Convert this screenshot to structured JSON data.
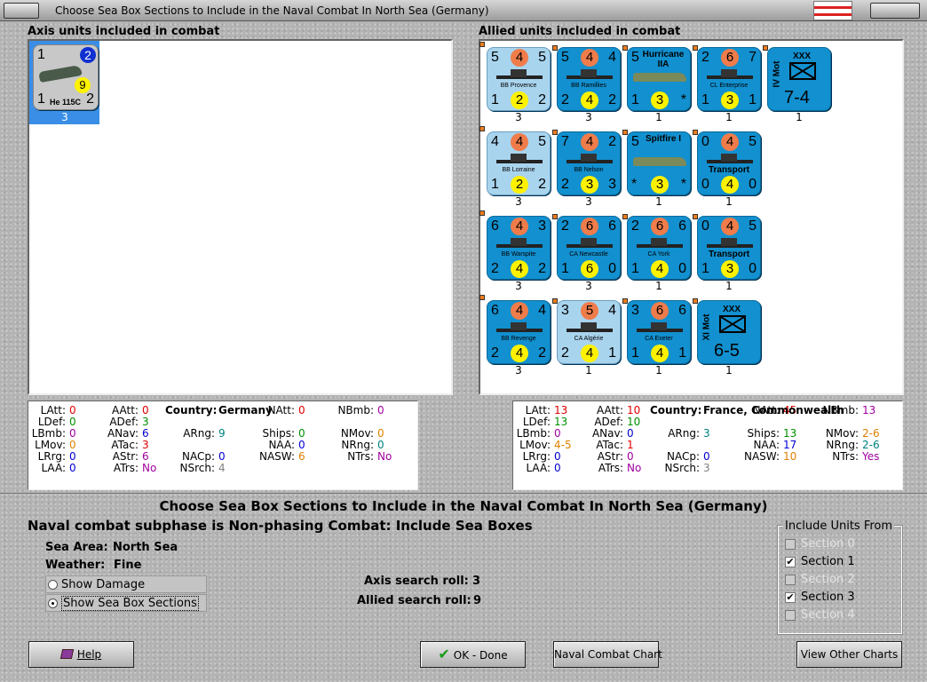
{
  "window": {
    "title": "Choose Sea Box Sections to Include in the Naval Combat In North Sea (Germany)"
  },
  "axis": {
    "heading": "Axis units included in combat",
    "units": [
      {
        "name": "He 115C",
        "tl": "1",
        "tr": "2",
        "mid": "9",
        "bl": "1",
        "br": "2",
        "count": "3"
      }
    ],
    "stats": {
      "LAtt": "0",
      "LDef": "0",
      "LBmb": "0",
      "LMov": "0",
      "LRrg": "0",
      "LAA": "0",
      "AAtt": "0",
      "ADef": "3",
      "ANav": "6",
      "ATac": "3",
      "AStr": "6",
      "ATrs": "No",
      "ARng": "9",
      "NACp": "0",
      "NSrch": "4",
      "country_label": "Country:",
      "country": "Germany",
      "NAtt": "0",
      "Ships": "0",
      "NAA": "0",
      "NASW": "6",
      "NBmb": "0",
      "NMov": "0",
      "NRng": "0",
      "NTrs": "No"
    }
  },
  "allied": {
    "heading": "Allied units included in combat",
    "units": [
      {
        "name": "BB Provence",
        "tl": "5",
        "o": "4",
        "tr": "5",
        "bl": "1",
        "y": "2",
        "br": "2",
        "count": "3",
        "light": true
      },
      {
        "name": "BB Ramillies",
        "tl": "5",
        "o": "4",
        "tr": "4",
        "bl": "2",
        "y": "4",
        "br": "2",
        "count": "3",
        "light": false
      },
      {
        "name": "Hurricane IIA",
        "tl": "5",
        "o": "",
        "tr": "",
        "bl": "1",
        "y": "3",
        "br": "*",
        "count": "1",
        "light": false
      },
      {
        "name": "CL Enterprise",
        "tl": "2",
        "o": "6",
        "tr": "7",
        "bl": "1",
        "y": "3",
        "br": "1",
        "count": "1",
        "light": false
      },
      {
        "name": "IV Mot",
        "corps": "XXX",
        "value": "7-4",
        "count": "1"
      },
      {
        "name": "BB Lorraine",
        "tl": "4",
        "o": "4",
        "tr": "5",
        "bl": "1",
        "y": "2",
        "br": "2",
        "count": "3",
        "light": true
      },
      {
        "name": "BB Nelson",
        "tl": "7",
        "o": "4",
        "tr": "2",
        "bl": "2",
        "y": "3",
        "br": "3",
        "count": "3",
        "light": false
      },
      {
        "name": "Spitfire I",
        "tl": "5",
        "o": "",
        "tr": "",
        "bl": "*",
        "y": "3",
        "br": "*",
        "count": "1",
        "light": false
      },
      {
        "name": "Transport",
        "tl": "0",
        "o": "4",
        "tr": "5",
        "bl": "0",
        "y": "4",
        "br": "0",
        "count": "1",
        "light": false
      },
      {
        "name": "BB Warspite",
        "tl": "6",
        "o": "4",
        "tr": "3",
        "bl": "2",
        "y": "4",
        "br": "2",
        "count": "3",
        "light": false
      },
      {
        "name": "CA Newcastle",
        "tl": "2",
        "o": "6",
        "tr": "6",
        "bl": "1",
        "y": "6",
        "br": "0",
        "count": "3",
        "light": false
      },
      {
        "name": "CA York",
        "tl": "2",
        "o": "6",
        "tr": "6",
        "bl": "1",
        "y": "4",
        "br": "0",
        "count": "1",
        "light": false
      },
      {
        "name": "Transport",
        "tl": "0",
        "o": "4",
        "tr": "5",
        "bl": "1",
        "y": "3",
        "br": "0",
        "count": "1",
        "light": false
      },
      {
        "name": "BB Revenge",
        "tl": "6",
        "o": "4",
        "tr": "4",
        "bl": "2",
        "y": "4",
        "br": "2",
        "count": "3",
        "light": false
      },
      {
        "name": "CA Algérie",
        "tl": "3",
        "o": "5",
        "tr": "4",
        "bl": "2",
        "y": "4",
        "br": "1",
        "count": "1",
        "light": true
      },
      {
        "name": "CA Exeter",
        "tl": "3",
        "o": "6",
        "tr": "6",
        "bl": "1",
        "y": "4",
        "br": "1",
        "count": "1",
        "light": false
      },
      {
        "name": "XI Mot",
        "corps": "XXX",
        "value": "6-5",
        "count": "1"
      }
    ],
    "stats": {
      "LAtt": "13",
      "LDef": "13",
      "LBmb": "0",
      "LMov": "4-5",
      "LRrg": "0",
      "LAA": "0",
      "AAtt": "10",
      "ADef": "10",
      "ANav": "0",
      "ATac": "1",
      "AStr": "0",
      "ATrs": "No",
      "ARng": "3",
      "NACp": "0",
      "NSrch": "3",
      "country_label": "Country:",
      "country": "France, Commonwealth",
      "NAtt": "45",
      "Ships": "13",
      "NAA": "17",
      "NASW": "10",
      "NBmb": "13",
      "NMov": "2-6",
      "NRng": "2-6",
      "NTrs": "Yes"
    }
  },
  "labels": {
    "LAtt": "LAtt:",
    "LDef": "LDef:",
    "LBmb": "LBmb:",
    "LMov": "LMov:",
    "LRrg": "LRrg:",
    "LAA": "LAA:",
    "AAtt": "AAtt:",
    "ADef": "ADef:",
    "ANav": "ANav:",
    "ATac": "ATac:",
    "AStr": "AStr:",
    "ATrs": "ATrs:",
    "ARng": "ARng:",
    "NACp": "NACp:",
    "NSrch": "NSrch:",
    "NAtt": "NAtt:",
    "Ships": "Ships:",
    "NAA": "NAA:",
    "NASW": "NASW:",
    "NBmb": "NBmb:",
    "NMov": "NMov:",
    "NRng": "NRng:",
    "NTrs": "NTrs:"
  },
  "main": {
    "title": "Choose Sea Box Sections to Include in the Naval Combat In North Sea (Germany)",
    "subphase": "Naval combat subphase is Non-phasing Combat: Include Sea Boxes",
    "sea_area_label": "Sea Area:",
    "sea_area": "North Sea",
    "weather_label": "Weather:",
    "weather": "Fine",
    "show_damage": "Show Damage",
    "show_sections": "Show Sea Box Sections",
    "axis_roll_label": "Axis search roll:",
    "axis_roll": "3",
    "allied_roll_label": "Allied search roll:",
    "allied_roll": "9"
  },
  "include": {
    "title": "Include Units From",
    "sections": [
      {
        "label": "Section 0",
        "checked": false,
        "enabled": false
      },
      {
        "label": "Section 1",
        "checked": true,
        "enabled": true
      },
      {
        "label": "Section 2",
        "checked": false,
        "enabled": false
      },
      {
        "label": "Section 3",
        "checked": true,
        "enabled": true
      },
      {
        "label": "Section 4",
        "checked": false,
        "enabled": false
      }
    ]
  },
  "buttons": {
    "help": "Help",
    "ok": "OK - Done",
    "naval_chart": "Naval Combat Chart",
    "other_charts": "View Other Charts"
  },
  "colors": {
    "counter_dark": "#1290cf",
    "counter_light": "#a9d4ee",
    "orange": "#ef7c4a",
    "yellow": "#fff200",
    "red": "#e00000",
    "green": "#009000",
    "blue": "#0000d0",
    "orange_text": "#e08000",
    "purple": "#a000a0",
    "teal": "#008080"
  }
}
